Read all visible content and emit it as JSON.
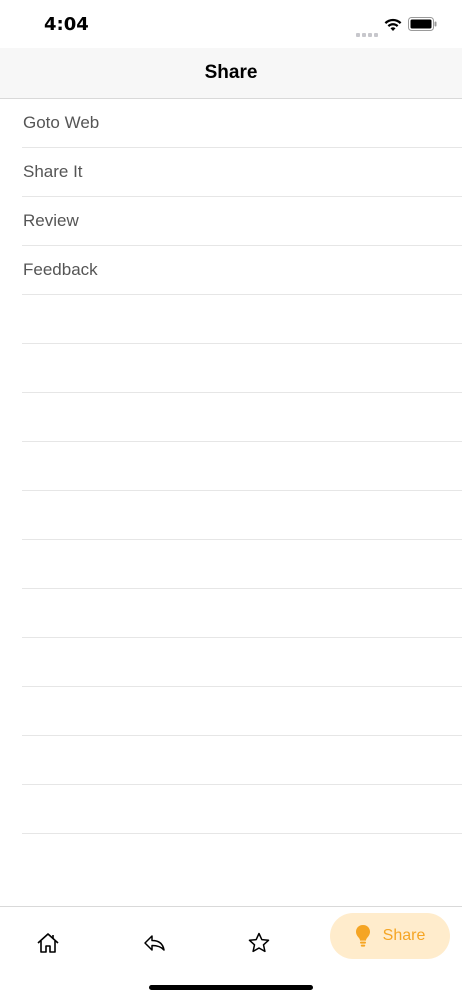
{
  "status_bar": {
    "time": "4:04"
  },
  "nav": {
    "title": "Share"
  },
  "list": {
    "items": [
      "Goto Web",
      "Share It",
      "Review",
      "Feedback",
      "",
      "",
      "",
      "",
      "",
      "",
      "",
      "",
      "",
      "",
      "",
      ""
    ]
  },
  "tab_bar": {
    "tabs": [
      {
        "icon": "home-icon"
      },
      {
        "icon": "reply-icon"
      },
      {
        "icon": "star-icon"
      },
      {
        "icon": "lightbulb-icon",
        "label": "Share",
        "selected": true
      }
    ],
    "accent_color": "#f5a524",
    "selected_bg": "#ffeccc"
  }
}
